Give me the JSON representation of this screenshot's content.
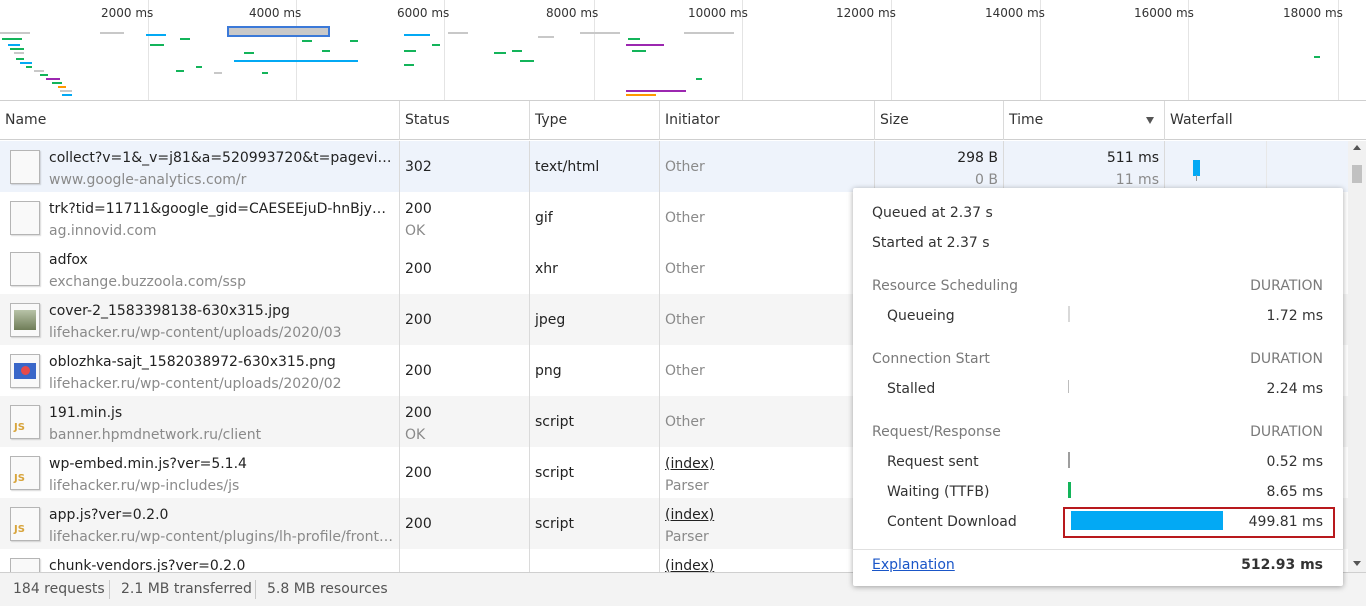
{
  "overview": {
    "ticks": [
      "2000 ms",
      "4000 ms",
      "6000 ms",
      "8000 ms",
      "10000 ms",
      "12000 ms",
      "14000 ms",
      "16000 ms",
      "18000 ms"
    ]
  },
  "columns": {
    "name": "Name",
    "status": "Status",
    "type": "Type",
    "initiator": "Initiator",
    "size": "Size",
    "time": "Time",
    "waterfall": "Waterfall"
  },
  "rows": [
    {
      "name": "collect?v=1&_v=j81&a=520993720&t=pageview...",
      "domain": "www.google-analytics.com/r",
      "status": "302",
      "status_text": "",
      "type": "text/html",
      "initiator": "Other",
      "initiator_sub": "",
      "size": "298 B",
      "size_sub": "0 B",
      "time": "511 ms",
      "time_sub": "11 ms",
      "icon": "blank-file-icon"
    },
    {
      "name": "trk?tid=11711&google_gid=CAESEEjuD-hnBjy8us...",
      "domain": "ag.innovid.com",
      "status": "200",
      "status_text": "OK",
      "type": "gif",
      "initiator": "Other",
      "initiator_sub": "",
      "icon": "blank-file-icon"
    },
    {
      "name": "adfox",
      "domain": "exchange.buzzoola.com/ssp",
      "status": "200",
      "status_text": "",
      "type": "xhr",
      "initiator": "Other",
      "initiator_sub": "",
      "icon": "blank-file-icon"
    },
    {
      "name": "cover-2_1583398138-630x315.jpg",
      "domain": "lifehacker.ru/wp-content/uploads/2020/03",
      "status": "200",
      "status_text": "",
      "type": "jpeg",
      "initiator": "Other",
      "initiator_sub": "",
      "icon": "image-file-icon"
    },
    {
      "name": "oblozhka-sajt_1582038972-630x315.png",
      "domain": "lifehacker.ru/wp-content/uploads/2020/02",
      "status": "200",
      "status_text": "",
      "type": "png",
      "initiator": "Other",
      "initiator_sub": "",
      "icon": "image-file-icon"
    },
    {
      "name": "191.min.js",
      "domain": "banner.hpmdnetwork.ru/client",
      "status": "200",
      "status_text": "OK",
      "type": "script",
      "initiator": "Other",
      "initiator_sub": "",
      "icon": "js-file-icon"
    },
    {
      "name": "wp-embed.min.js?ver=5.1.4",
      "domain": "lifehacker.ru/wp-includes/js",
      "status": "200",
      "status_text": "",
      "type": "script",
      "initiator": "(index)",
      "initiator_sub": "Parser",
      "icon": "js-file-icon"
    },
    {
      "name": "app.js?ver=0.2.0",
      "domain": "lifehacker.ru/wp-content/plugins/lh-profile/fronte...",
      "status": "200",
      "status_text": "",
      "type": "script",
      "initiator": "(index)",
      "initiator_sub": "Parser",
      "icon": "js-file-icon"
    },
    {
      "name": "chunk-vendors.js?ver=0.2.0",
      "domain": "",
      "status": "",
      "status_text": "",
      "type": "",
      "initiator": "(index)",
      "initiator_sub": "",
      "icon": "js-file-icon"
    }
  ],
  "timing": {
    "queued": "Queued at 2.37 s",
    "started": "Started at 2.37 s",
    "sections": [
      {
        "title": "Resource Scheduling",
        "duration_label": "DURATION",
        "items": [
          {
            "label": "Queueing",
            "value": "1.72 ms",
            "color": "#d9d9d9"
          }
        ]
      },
      {
        "title": "Connection Start",
        "duration_label": "DURATION",
        "items": [
          {
            "label": "Stalled",
            "value": "2.24 ms",
            "color": "#bdbdbd"
          }
        ]
      },
      {
        "title": "Request/Response",
        "duration_label": "DURATION",
        "items": [
          {
            "label": "Request sent",
            "value": "0.52 ms",
            "color": "#9e9e9e"
          },
          {
            "label": "Waiting (TTFB)",
            "value": "8.65 ms",
            "color": "#13b45a"
          },
          {
            "label": "Content Download",
            "value": "499.81 ms",
            "color": "#03a9f4"
          }
        ]
      }
    ],
    "explanation": "Explanation",
    "total": "512.93 ms"
  },
  "footer": {
    "requests": "184 requests",
    "transferred": "2.1 MB transferred",
    "resources": "5.8 MB resources"
  },
  "colors": {
    "accent": "#03a9f4",
    "ttfb": "#13b45a",
    "highlight": "#b8191d",
    "link": "#1a56c8"
  }
}
